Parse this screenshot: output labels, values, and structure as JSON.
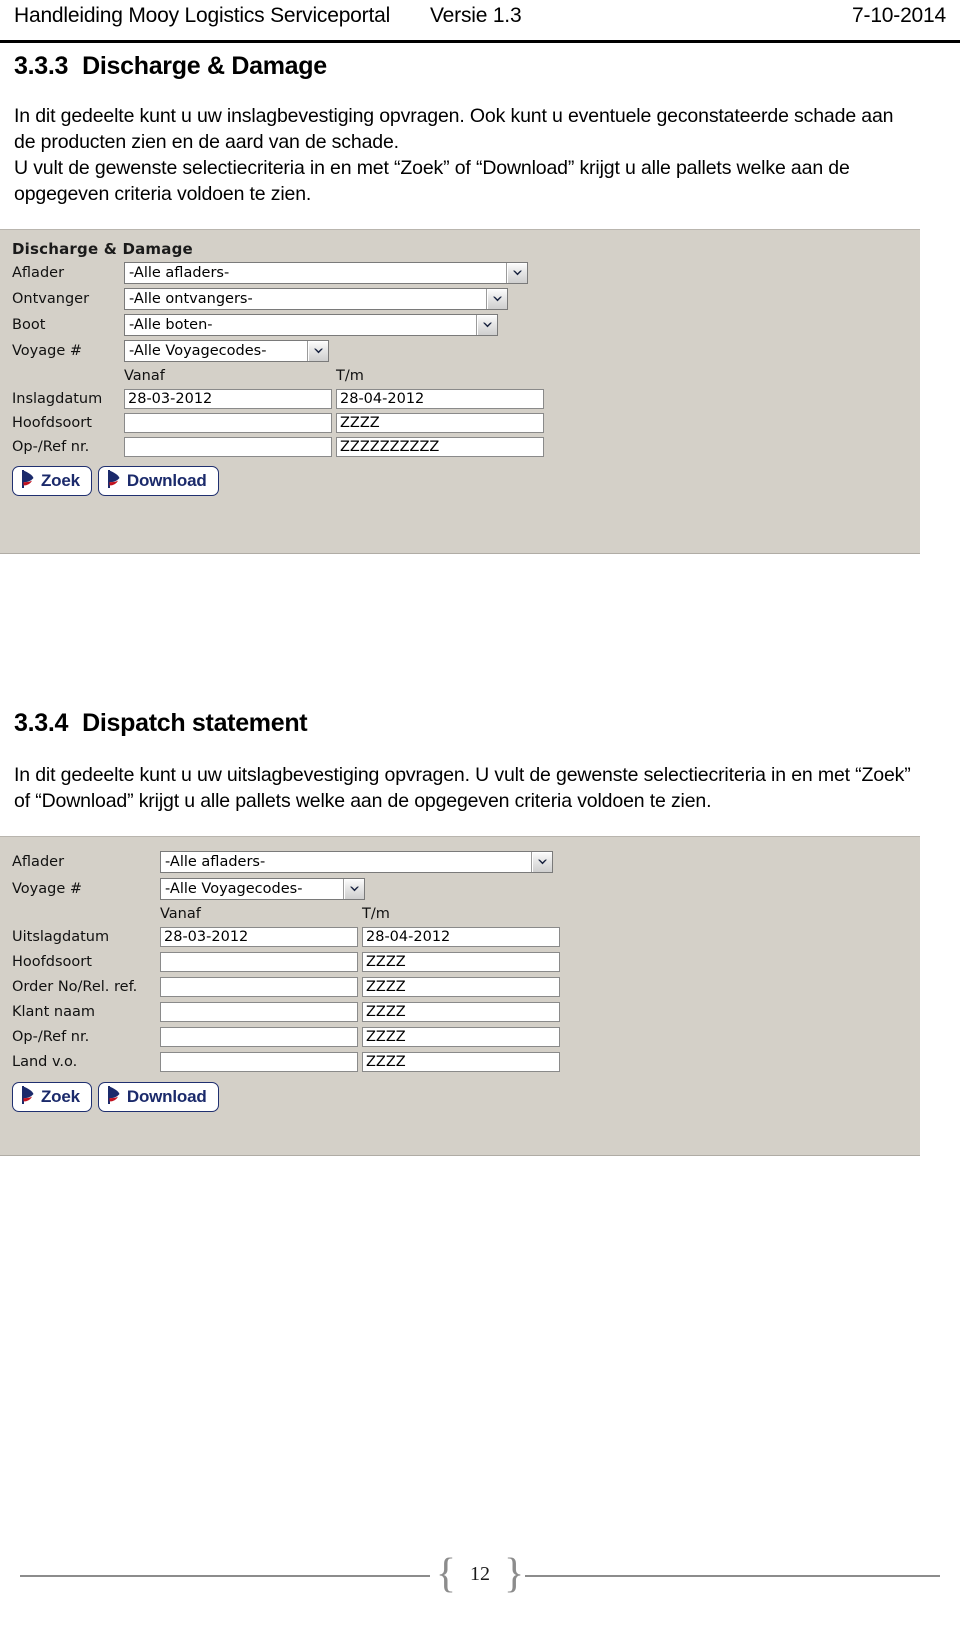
{
  "header": {
    "title": "Handleiding Mooy Logistics Serviceportal",
    "version": "Versie 1.3",
    "date": "7-10-2014"
  },
  "sections": [
    {
      "number": "3.3.3",
      "title": "Discharge & Damage",
      "paragraphs": [
        "In dit gedeelte kunt u uw inslagbevestiging opvragen. Ook kunt u eventuele geconstateerde schade aan de producten zien en de aard van de schade.",
        "U vult de gewenste selectiecriteria in en met “Zoek” of “Download” krijgt u alle pallets welke aan de opgegeven criteria voldoen te zien."
      ]
    },
    {
      "number": "3.3.4",
      "title": "Dispatch statement",
      "paragraphs": [
        "In dit gedeelte kunt u uw uitslagbevestiging opvragen. U vult de gewenste selectiecriteria in en met “Zoek” of “Download” krijgt u alle pallets welke aan de opgegeven criteria voldoen te zien."
      ]
    }
  ],
  "form_discharge": {
    "panel_title": "Discharge & Damage",
    "selects": [
      {
        "label": "Aflader",
        "value": "-Alle afladers-"
      },
      {
        "label": "Ontvanger",
        "value": "-Alle ontvangers-"
      },
      {
        "label": "Boot",
        "value": "-Alle boten-"
      },
      {
        "label": "Voyage #",
        "value": "-Alle Voyagecodes-"
      }
    ],
    "column_headers": {
      "from": "Vanaf",
      "to": "T/m"
    },
    "rows": [
      {
        "label": "Inslagdatum",
        "from": "28-03-2012",
        "to": "28-04-2012"
      },
      {
        "label": "Hoofdsoort",
        "from": "",
        "to": "ZZZZ"
      },
      {
        "label": "Op-/Ref nr.",
        "from": "",
        "to": "ZZZZZZZZZZ"
      }
    ],
    "buttons": [
      {
        "label": "Zoek",
        "icon": "flag-icon"
      },
      {
        "label": "Download",
        "icon": "flag-icon"
      }
    ]
  },
  "form_dispatch": {
    "selects": [
      {
        "label": "Aflader",
        "value": "-Alle afladers-"
      },
      {
        "label": "Voyage #",
        "value": "-Alle Voyagecodes-"
      }
    ],
    "column_headers": {
      "from": "Vanaf",
      "to": "T/m"
    },
    "rows": [
      {
        "label": "Uitslagdatum",
        "from": "28-03-2012",
        "to": "28-04-2012"
      },
      {
        "label": "Hoofdsoort",
        "from": "",
        "to": "ZZZZ"
      },
      {
        "label": "Order No/Rel. ref.",
        "from": "",
        "to": "ZZZZ"
      },
      {
        "label": "Klant naam",
        "from": "",
        "to": "ZZZZ"
      },
      {
        "label": "Op-/Ref nr.",
        "from": "",
        "to": "ZZZZ"
      },
      {
        "label": "Land v.o.",
        "from": "",
        "to": "ZZZZ"
      }
    ],
    "buttons": [
      {
        "label": "Zoek",
        "icon": "flag-icon"
      },
      {
        "label": "Download",
        "icon": "flag-icon"
      }
    ]
  },
  "footer": {
    "page_number": "12",
    "brace_left": "{",
    "brace_right": "}"
  },
  "colors": {
    "panel_bg": "#d4d0c8",
    "button_text": "#1b2a6b",
    "icon_navy": "#1b2a6b",
    "icon_red": "#c1121f",
    "footer_rule": "#8c8c8c"
  }
}
